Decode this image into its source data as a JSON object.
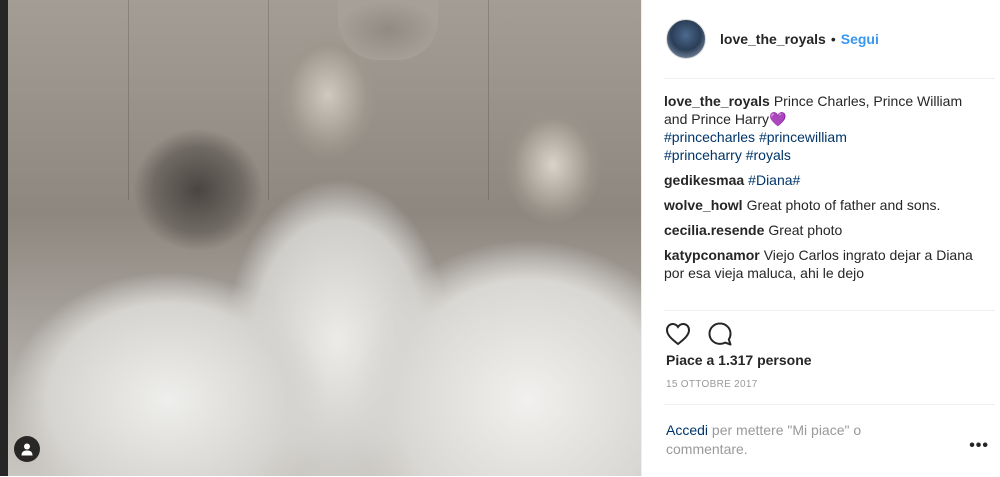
{
  "post": {
    "username": "love_the_royals",
    "separator": "•",
    "follow_label": "Segui"
  },
  "comments": [
    {
      "user": "love_the_royals",
      "text": "Prince Charles, Prince William and Prince Harry",
      "emoji": "💜",
      "hashtags": [
        "#princecharles",
        "#princewilliam",
        "#princeharry",
        "#royals"
      ]
    },
    {
      "user": "gedikesmaa",
      "tag": "#Diana#"
    },
    {
      "user": "wolve_howl",
      "text": "Great photo of father and sons."
    },
    {
      "user": "cecilia.resende",
      "text": "Great photo"
    },
    {
      "user": "katypconamor",
      "text": "Viejo Carlos ingrato dejar a Diana por esa vieja maluca, ahi le dejo"
    }
  ],
  "likes_text": "Piace a 1.317 persone",
  "date_text": "15 OTTOBRE 2017",
  "footer": {
    "login_link": "Accedi",
    "rest_text": " per mettere \"Mi piace\" o commentare.",
    "more_label": "•••"
  },
  "icons": {
    "like": "heart-outline-icon",
    "comment": "comment-bubble-icon",
    "user_tag": "person-icon"
  },
  "colors": {
    "link_blue": "#3897f0",
    "hashtag": "#003569",
    "muted": "#999999",
    "text": "#262626"
  }
}
